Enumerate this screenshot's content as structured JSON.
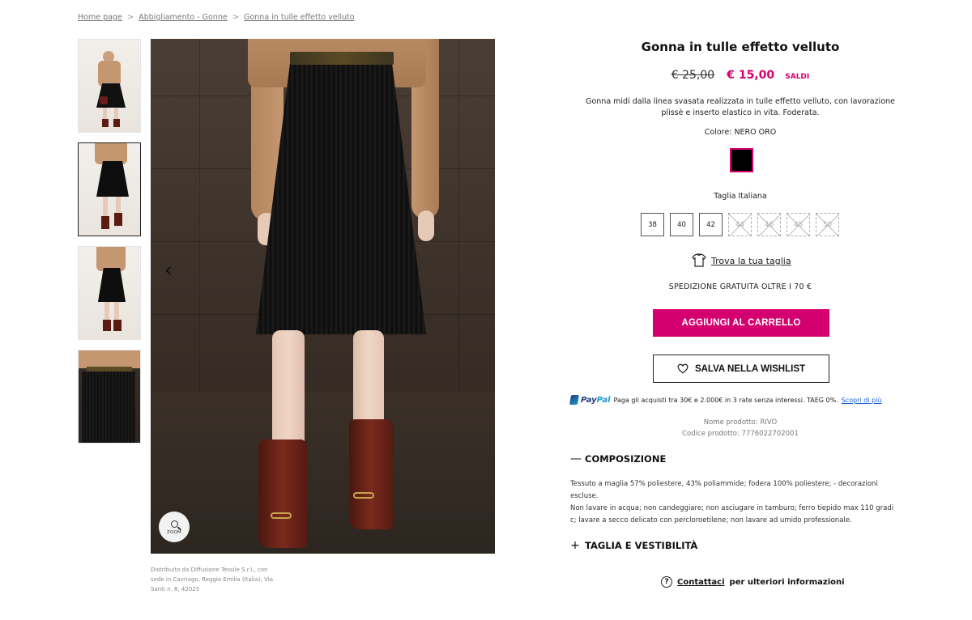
{
  "breadcrumb": {
    "items": [
      "Home page",
      "Abbigliamento - Gonne",
      "Gonna in tulle effetto velluto"
    ],
    "separator": ">"
  },
  "gallery": {
    "prev_arrow": "‹",
    "next_arrow": "›",
    "zoom_label": "ZOOM",
    "icons": [
      "chevron-left-icon",
      "chevron-right-icon",
      "search-icon"
    ]
  },
  "distributor": "Distribuito da Diffusione Tessile S.r.l., con sede in Cavriago, Reggio Emilia (Italia), Via Santi n. 8, 42025",
  "product": {
    "title": "Gonna in tulle effetto velluto",
    "old_price": "€ 25,00",
    "new_price": "€ 15,00",
    "sale_tag": "SALDI",
    "description": "Gonna midi dalla linea svasata realizzata in tulle effetto velluto, con lavorazione plissè e inserto elastico in vita. Foderata.",
    "color_label": "Colore: NERO ORO",
    "size_label": "Taglia Italiana",
    "sizes": [
      {
        "label": "38",
        "available": true
      },
      {
        "label": "40",
        "available": true
      },
      {
        "label": "42",
        "available": true
      },
      {
        "label": "44",
        "available": false
      },
      {
        "label": "46",
        "available": false
      },
      {
        "label": "48",
        "available": false
      },
      {
        "label": "50",
        "available": false
      }
    ],
    "find_size": "Trova la tua taglia",
    "shipping": "SPEDIZIONE GRATUITA OLTRE I 70 €",
    "add_to_cart": "AGGIUNGI AL CARRELLO",
    "wishlist": "SALVA NELLA WISHLIST",
    "paypal": {
      "logo_pay": "Pay",
      "logo_pal": "Pal",
      "text": "Paga gli acquisti tra 30€ e 2.000€ in 3 rate senza interessi. TAEG 0%.",
      "link": "Scopri di più"
    },
    "product_name": "Nome prodotto: RIVO",
    "product_code": "Codice prodotto:  7776022702001",
    "composition": {
      "heading": "COMPOSIZIONE",
      "sign": "—",
      "line1": "Tessuto a maglia 57% poliestere, 43% poliammide; fodera 100% poliestere; - decorazioni escluse.",
      "line2": "Non lavare in acqua; non candeggiare; non asciugare in tamburo; ferro tiepido max 110 gradi c; lavare a secco delicato con percloroetilene; non lavare ad umido professionale."
    },
    "fit": {
      "heading": "TAGLIA E VESTIBILITÀ",
      "sign": "+"
    },
    "contact": {
      "icon_glyph": "?",
      "link": "Contattaci",
      "rest": "per ulteriori informazioni"
    }
  },
  "colors": {
    "accent": "#d4006f",
    "swatch": "#000000",
    "paypal_dark": "#253b80",
    "paypal_light": "#179bd7"
  }
}
